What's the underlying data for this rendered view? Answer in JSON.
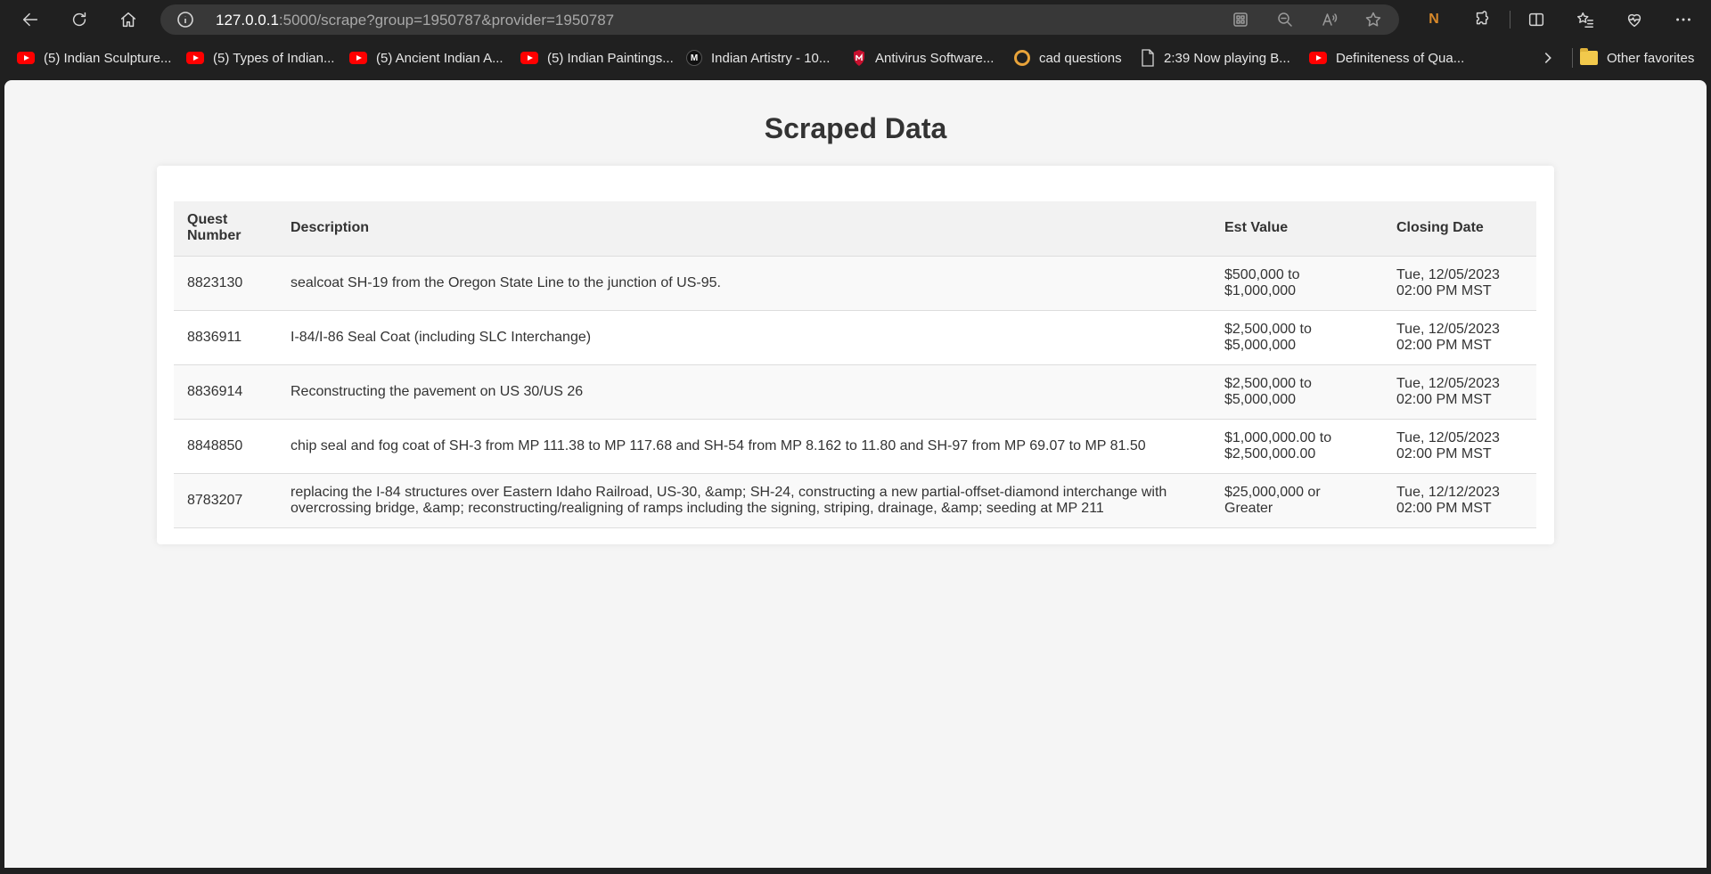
{
  "browser": {
    "url_host": "127.0.0.1",
    "url_path": ":5000/scrape?group=1950787&provider=1950787",
    "ext_label": "N"
  },
  "favorites": [
    {
      "label": "(5) Indian Sculpture...",
      "icon": "youtube-icon"
    },
    {
      "label": "(5) Types of Indian...",
      "icon": "youtube-icon"
    },
    {
      "label": "(5) Ancient Indian A...",
      "icon": "youtube-icon"
    },
    {
      "label": "(5) Indian Paintings...",
      "icon": "youtube-icon"
    },
    {
      "label": "Indian Artistry - 10...",
      "icon": "m-logo-icon",
      "icon_text": "M"
    },
    {
      "label": "Antivirus Software...",
      "icon": "shield-icon"
    },
    {
      "label": "cad questions",
      "icon": "q-icon"
    },
    {
      "label": "2:39 Now playing B...",
      "icon": "document-icon"
    },
    {
      "label": "Definiteness of Qua...",
      "icon": "youtube-icon"
    }
  ],
  "other_favorites": "Other favorites",
  "page": {
    "title": "Scraped Data",
    "table": {
      "headers": [
        "Quest Number",
        "Description",
        "Est Value",
        "Closing Date"
      ],
      "rows": [
        {
          "quest": "8823130",
          "description": "sealcoat SH-19 from the Oregon State Line to the junction of US-95.",
          "value": "$500,000 to $1,000,000",
          "date": "Tue, 12/05/2023 02:00 PM MST"
        },
        {
          "quest": "8836911",
          "description": "I-84/I-86 Seal Coat (including SLC Interchange)",
          "value": "$2,500,000 to $5,000,000",
          "date": "Tue, 12/05/2023 02:00 PM MST"
        },
        {
          "quest": "8836914",
          "description": "Reconstructing the pavement on US 30/US 26",
          "value": "$2,500,000 to $5,000,000",
          "date": "Tue, 12/05/2023 02:00 PM MST"
        },
        {
          "quest": "8848850",
          "description": "chip seal and fog coat of SH-3 from MP 111.38 to MP 117.68 and SH-54 from MP 8.162 to 11.80 and SH-97 from MP 69.07 to MP 81.50",
          "value": "$1,000,000.00 to $2,500,000.00",
          "date": "Tue, 12/05/2023 02:00 PM MST"
        },
        {
          "quest": "8783207",
          "description": "replacing the I-84 structures over Eastern Idaho Railroad, US-30, &amp; SH-24, constructing a new partial-offset-diamond interchange with overcrossing bridge, &amp; reconstructing/realigning of ramps including the signing, striping, drainage, &amp; seeding at MP 211",
          "value": "$25,000,000 or Greater",
          "date": "Tue, 12/12/2023 02:00 PM MST"
        }
      ]
    }
  }
}
